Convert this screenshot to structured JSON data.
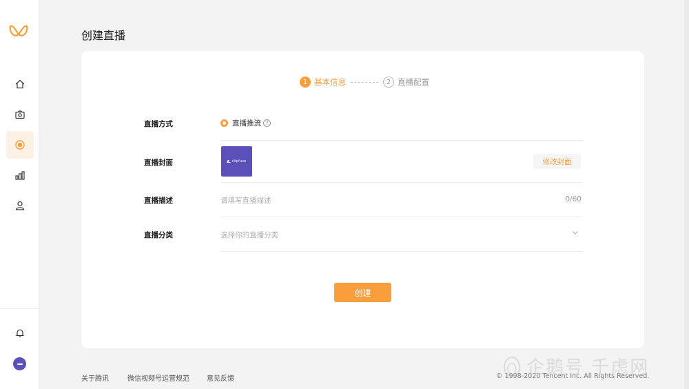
{
  "page": {
    "title": "创建直播"
  },
  "sidebar": {
    "logo": "channels-logo",
    "items": [
      {
        "icon": "home-icon",
        "active": false
      },
      {
        "icon": "camera-icon",
        "active": false
      },
      {
        "icon": "live-icon",
        "active": true
      },
      {
        "icon": "bar-chart-icon",
        "active": false
      },
      {
        "icon": "user-icon",
        "active": false
      }
    ],
    "bottom": [
      {
        "icon": "bell-icon"
      },
      {
        "icon": "avatar"
      }
    ]
  },
  "steps": [
    {
      "num": "1",
      "label": "基本信息",
      "active": true
    },
    {
      "num": "2",
      "label": "直播配置",
      "active": false
    }
  ],
  "form": {
    "method": {
      "label": "直播方式",
      "option": "直播推流",
      "help": "?"
    },
    "cover": {
      "label": "直播封面",
      "change_button": "修改封面",
      "image_text": "clipfuse"
    },
    "description": {
      "label": "直播描述",
      "placeholder": "请填写直播描述",
      "count": "0/60"
    },
    "category": {
      "label": "直播分类",
      "placeholder": "选择你的直播分类"
    }
  },
  "create_button": "创建",
  "footer": {
    "links": [
      "关于腾讯",
      "微信视频号运营规范",
      "意见反馈"
    ],
    "copyright": "© 1998-2020 Tencent Inc. All Rights Reserved."
  },
  "watermark": "企鹅号 千虑网",
  "colors": {
    "accent": "#fa9d3b",
    "cover_bg": "#5b4fb8"
  }
}
